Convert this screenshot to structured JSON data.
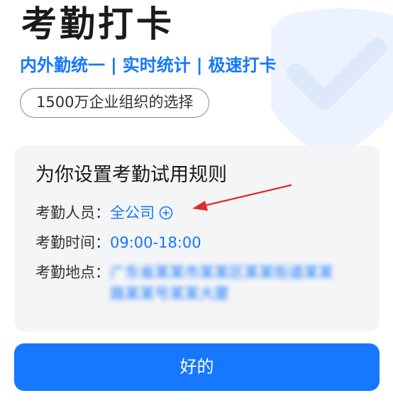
{
  "header": {
    "title": "考勤打卡",
    "subtitle_items": [
      "内外勤统一",
      "实时统计",
      "极速打卡"
    ],
    "separator": "|",
    "badge": "1500万企业组织的选择"
  },
  "card": {
    "title": "为你设置考勤试用规则",
    "staff_label": "考勤人员：",
    "staff_value": "全公司",
    "time_label": "考勤时间：",
    "time_value": "09:00-18:00",
    "place_label": "考勤地点：",
    "place_value": "广东省某某市某某区某某街道某某路某某号某某大厦"
  },
  "button": {
    "label": "好的"
  },
  "icons": {
    "watermark": "check-shield-icon",
    "add": "plus-circle-icon",
    "annotation": "red-arrow-icon"
  },
  "colors": {
    "accent": "#1677ff",
    "annotation": "#e8262a",
    "card_bg": "#f4f5f7"
  }
}
